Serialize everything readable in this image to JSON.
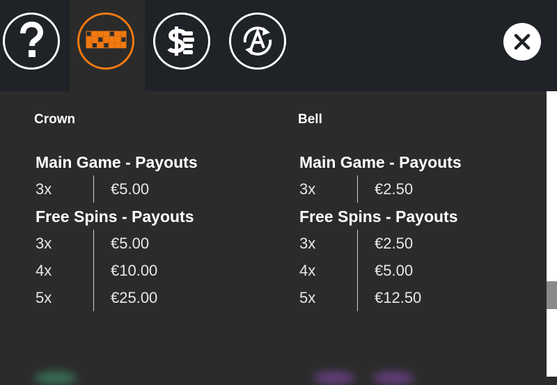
{
  "toolbar": {
    "tabs": [
      {
        "name": "help",
        "icon": "question-icon",
        "active": false
      },
      {
        "name": "paytable",
        "icon": "paytable-grid-icon",
        "active": true
      },
      {
        "name": "bet-settings",
        "icon": "coins-dollar-icon",
        "active": false
      },
      {
        "name": "autoplay",
        "icon": "autoplay-a-icon",
        "active": false
      }
    ],
    "close_icon": "close-icon"
  },
  "symbols": [
    {
      "name": "Crown",
      "main_title": "Main Game - Payouts",
      "main": [
        {
          "mult": "3x",
          "pay": "€5.00"
        }
      ],
      "free_title": "Free Spins - Payouts",
      "free": [
        {
          "mult": "3x",
          "pay": "€5.00"
        },
        {
          "mult": "4x",
          "pay": "€10.00"
        },
        {
          "mult": "5x",
          "pay": "€25.00"
        }
      ]
    },
    {
      "name": "Bell",
      "main_title": "Main Game - Payouts",
      "main": [
        {
          "mult": "3x",
          "pay": "€2.50"
        }
      ],
      "free_title": "Free Spins - Payouts",
      "free": [
        {
          "mult": "3x",
          "pay": "€2.50"
        },
        {
          "mult": "4x",
          "pay": "€5.00"
        },
        {
          "mult": "5x",
          "pay": "€12.50"
        }
      ]
    }
  ],
  "colors": {
    "accent": "#f47a10",
    "topbar": "#1f2227",
    "panel": "#2b2b2b"
  }
}
